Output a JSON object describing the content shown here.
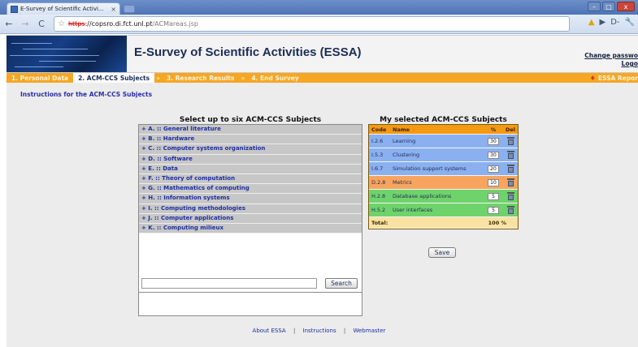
{
  "browser": {
    "tab_title": "E-Survey of Scientific Activi...",
    "tab_close": "×",
    "url_protocol": "https",
    "url_host": "://copsro.di.fct.unl.pt",
    "url_path": "/ACMareas.jsp",
    "back_glyph": "←",
    "forward_glyph": "→",
    "reload_glyph": "C",
    "star_glyph": "☆",
    "warn_glyph": "▲",
    "play_glyph": "▶",
    "page_glyph": "D-",
    "wrench_glyph": "🔧",
    "win_min": "–",
    "win_max": "□",
    "win_close": "x"
  },
  "header": {
    "title": "E-Survey of Scientific Activities (ESSA)",
    "change_password": "Change passwo",
    "logout": "Logo"
  },
  "steps": {
    "items": [
      "1. Personal Data",
      "2. ACM-CCS Subjects",
      "3. Research Results",
      "4. End Survey"
    ],
    "separator": "»",
    "report_label": "ESSA Repor"
  },
  "main": {
    "instructions_link": "Instructions for the ACM-CCS Subjects",
    "left_heading": "Select up to six ACM-CCS Subjects",
    "subjects": [
      "+ A. :: General literature",
      "+ B. :: Hardware",
      "+ C. :: Computer systems organization",
      "+ D. :: Software",
      "+ E. :: Data",
      "+ F. :: Theory of computation",
      "+ G. :: Mathematics of computing",
      "+ H. :: Information systems",
      "+ I. :: Computing methodologies",
      "+ J. :: Computer applications",
      "+ K. :: Computing milieux"
    ],
    "search_button": "Search",
    "right_heading": "My selected ACM-CCS Subjects",
    "table_headers": {
      "code": "Code",
      "name": "Name",
      "pct": "%",
      "del": "Del"
    },
    "selected": [
      {
        "code": "I.2.6",
        "name": "Learning",
        "pct": "30",
        "color": "#8ab0f0"
      },
      {
        "code": "I.5.3",
        "name": "Clustering",
        "pct": "30",
        "color": "#8ab0f0"
      },
      {
        "code": "I.6.7",
        "name": "Simulation support systems",
        "pct": "20",
        "color": "#8ab0f0"
      },
      {
        "code": "D.2.8",
        "name": "Metrics",
        "pct": "10",
        "color": "#f7a55e"
      },
      {
        "code": "H.2.8",
        "name": "Database applications",
        "pct": "5",
        "color": "#6fd36b"
      },
      {
        "code": "H.5.2",
        "name": "User interfaces",
        "pct": "5",
        "color": "#6fd36b"
      }
    ],
    "total_label": "Total:",
    "total_value": "100 %",
    "save_button": "Save"
  },
  "footer": {
    "links": [
      "About ESSA",
      "Instructions",
      "Webmaster"
    ],
    "separator": "|"
  },
  "colors": {
    "steps_bar": "#f5a623",
    "table_header": "#f39a12",
    "total_row": "#fbe2a3",
    "link": "#1f2fa0"
  }
}
